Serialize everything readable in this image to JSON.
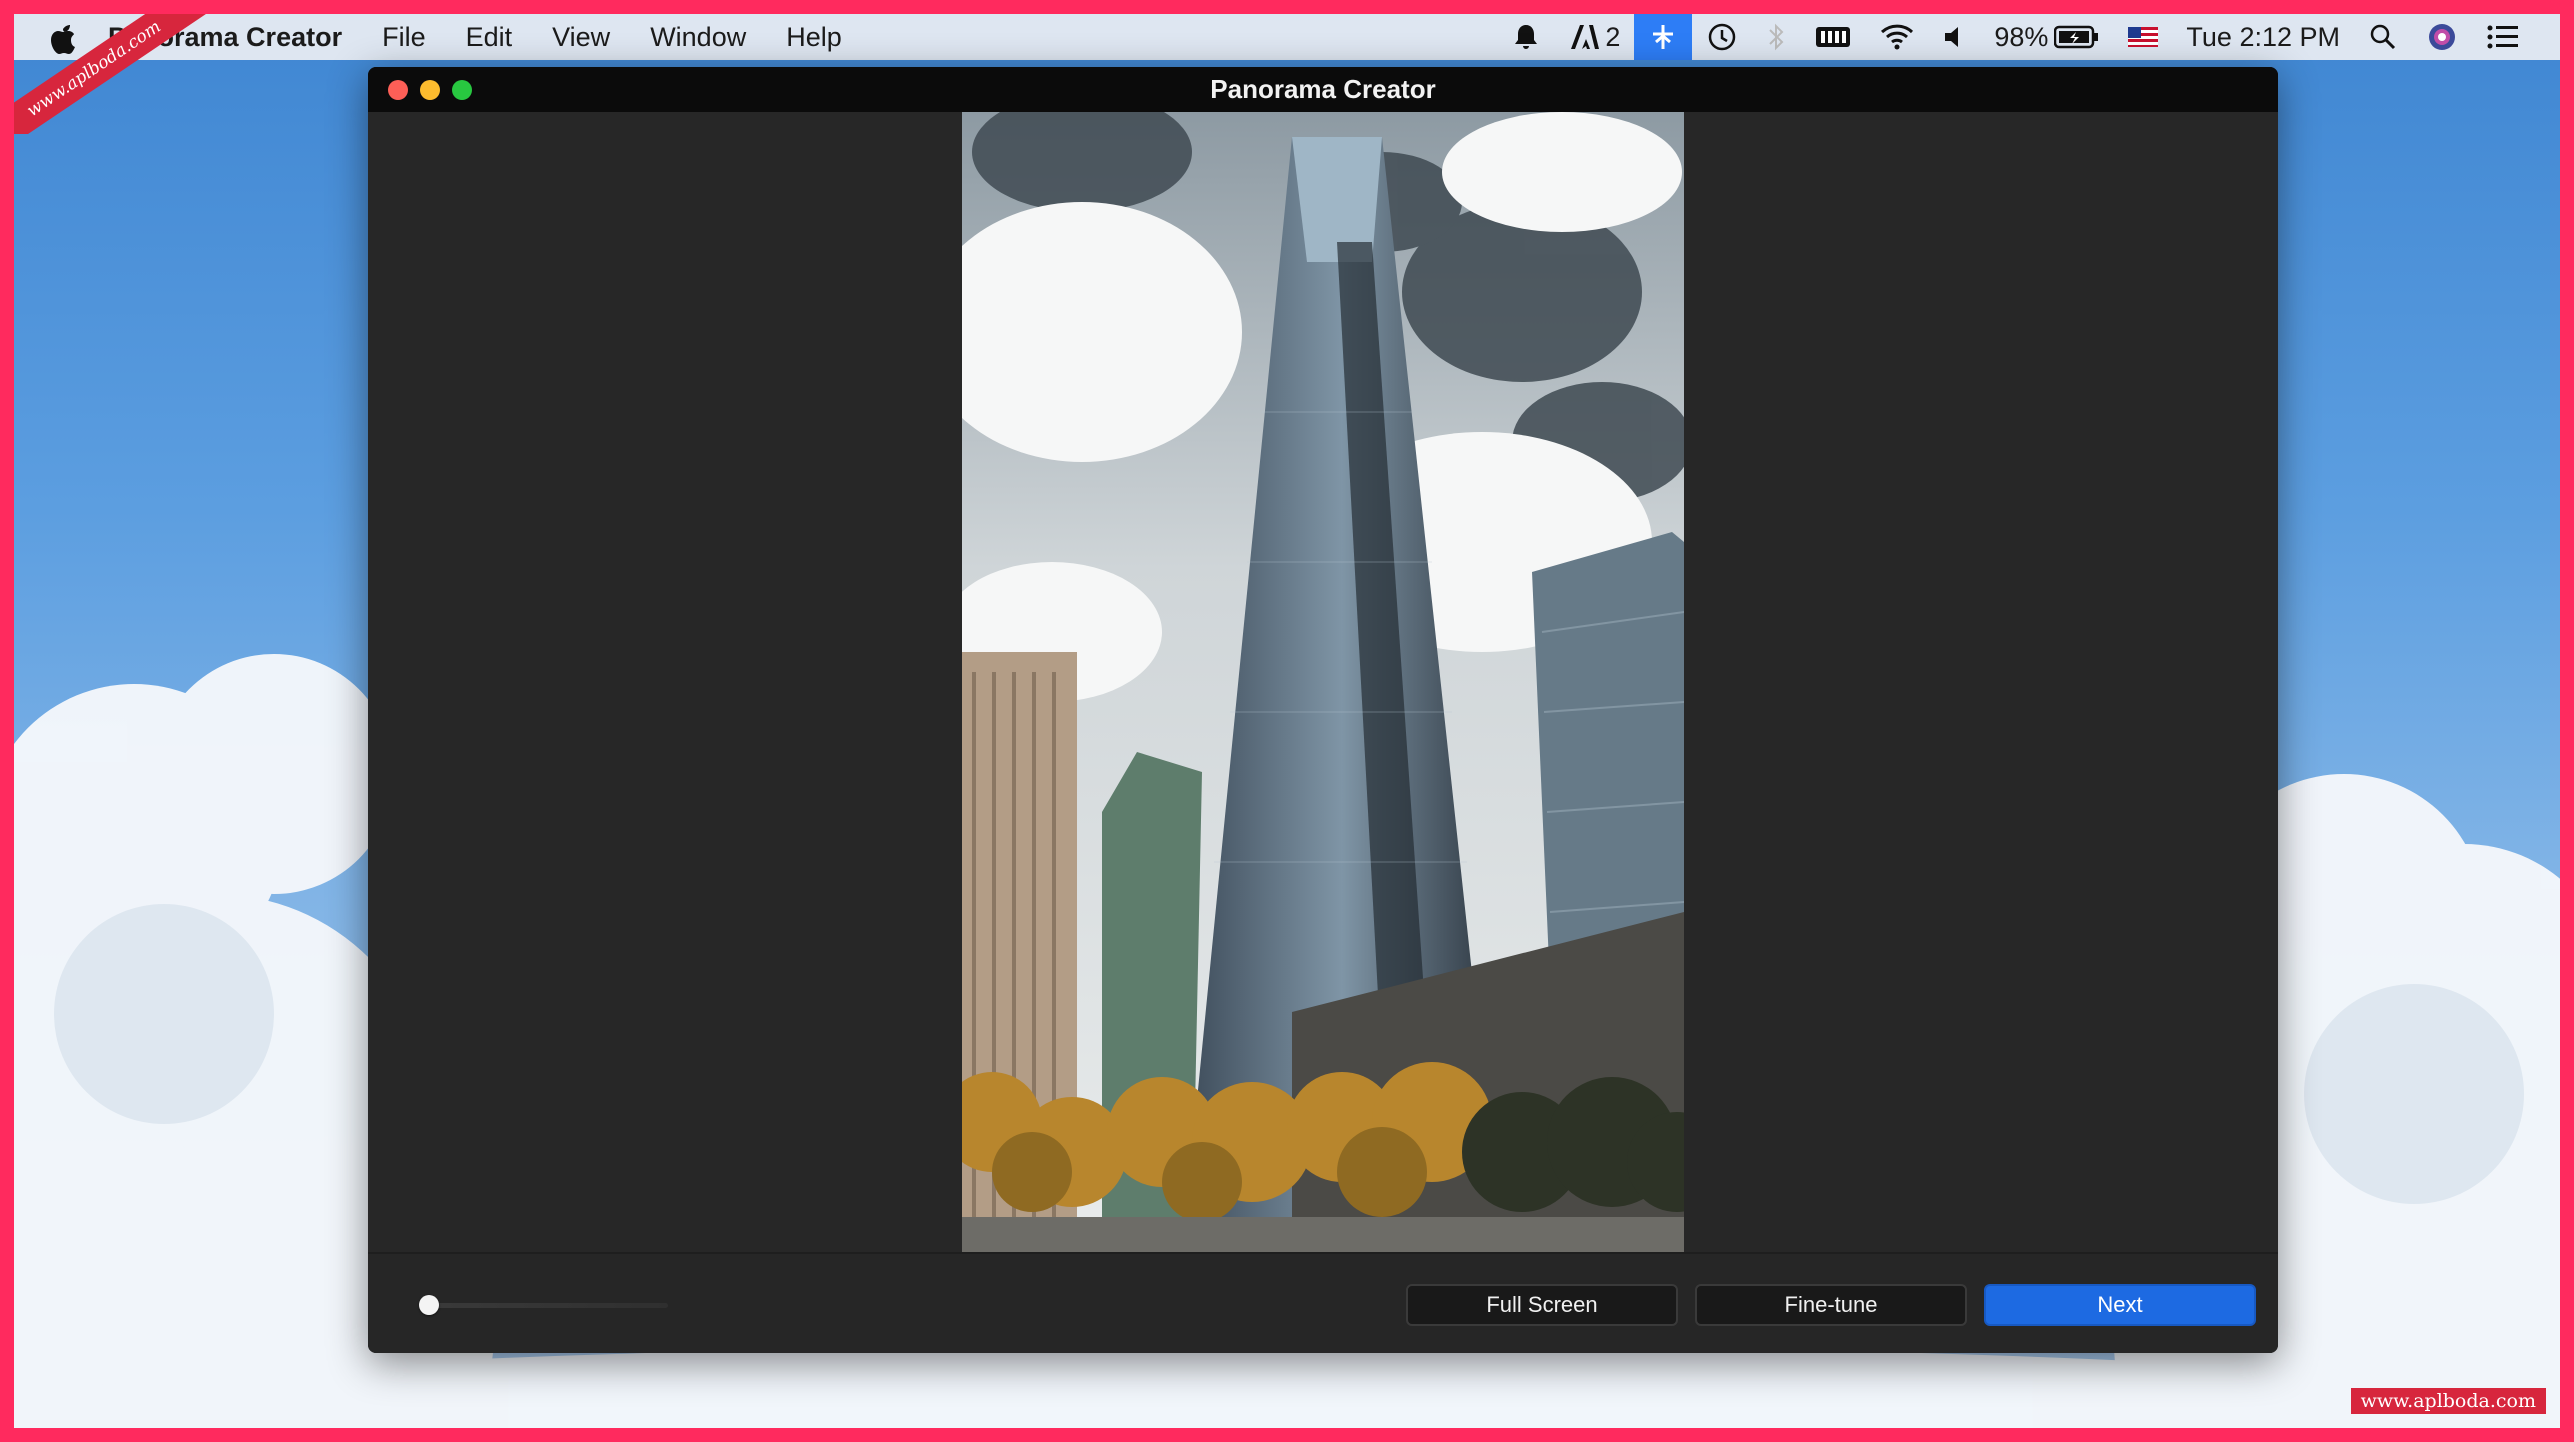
{
  "menubar": {
    "app_name": "Panorama Creator",
    "items": [
      "File",
      "Edit",
      "View",
      "Window",
      "Help"
    ],
    "status": {
      "notification_badge": "2",
      "battery": "98%",
      "clock": "Tue 2:12 PM"
    }
  },
  "window": {
    "title": "Panorama Creator"
  },
  "controls": {
    "slider_value": 0.03,
    "full_screen_label": "Full Screen",
    "fine_tune_label": "Fine-tune",
    "next_label": "Next"
  },
  "watermark": {
    "corner_text": "www.aplboda.com",
    "footer_text": "www.aplboda.com"
  },
  "colors": {
    "primary_button": "#1d6ae2",
    "window_bg": "#272727",
    "frame": "#ff2a5e"
  }
}
